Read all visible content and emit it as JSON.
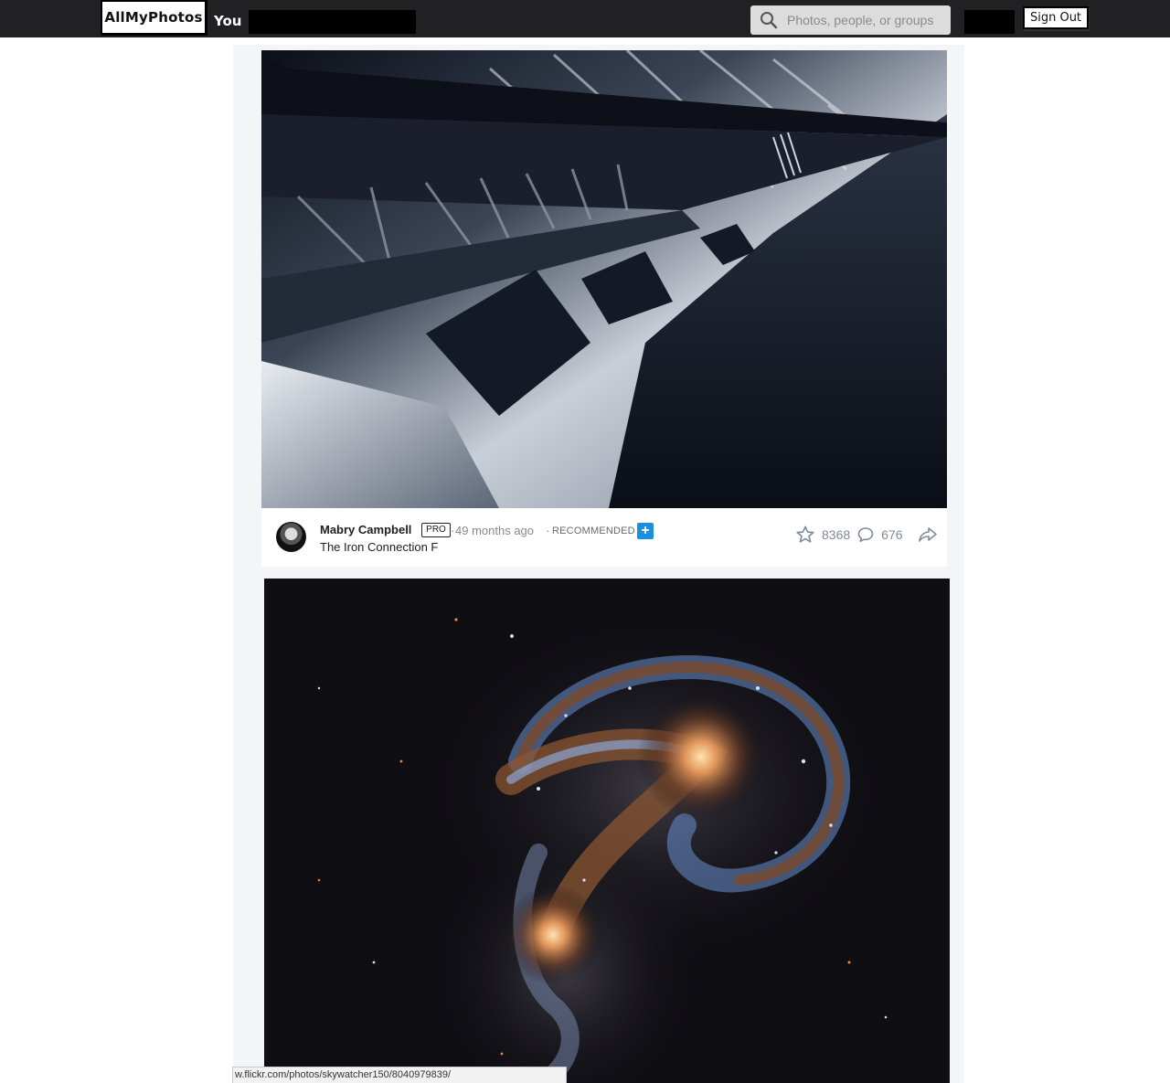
{
  "header": {
    "logo_text": "AllMyPhotos",
    "nav_you": "You",
    "search_placeholder": "Photos, people, or groups",
    "signout_label": "Sign Out"
  },
  "feed": {
    "post1": {
      "author": "Mabry Campbell",
      "badge": "PRO",
      "separator": "·",
      "time": "49 months ago",
      "recommended": "RECOMMENDED",
      "plus": "+",
      "title": "The Iron Connection F",
      "faves": "8368",
      "comments": "676"
    }
  },
  "status_bar": {
    "url": "w.flickr.com/photos/skywatcher150/8040979839/"
  },
  "icons": {
    "search": "search-icon",
    "star": "star-icon",
    "comment": "comment-icon",
    "share": "share-icon",
    "add": "plus-icon"
  },
  "colors": {
    "topbar": "#212124",
    "accent_plus": "#1c8ede",
    "stat_gray": "#7e8a97"
  }
}
